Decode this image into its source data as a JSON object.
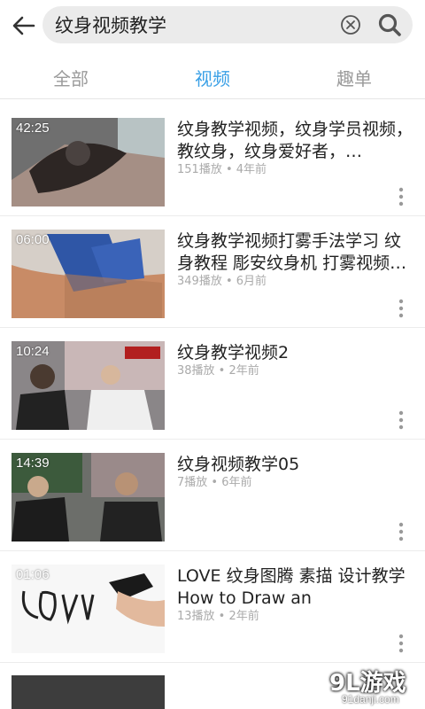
{
  "search": {
    "query": "纹身视频教学"
  },
  "tabs": [
    {
      "label": "全部"
    },
    {
      "label": "视频"
    },
    {
      "label": "趣单"
    }
  ],
  "active_tab": "视频",
  "accent_color": "#3aa0e6",
  "videos": [
    {
      "duration": "42:25",
      "title": "纹身教学视频，纹身学员视频，教纹身，纹身爱好者，…",
      "plays": "151播放",
      "age": "4年前"
    },
    {
      "duration": "06:00",
      "title": "纹身教学视频打雾手法学习 纹身教程 彫安纹身机 打雾视频…",
      "plays": "349播放",
      "age": "6月前"
    },
    {
      "duration": "10:24",
      "title": "纹身教学视频2",
      "plays": "38播放",
      "age": "2年前"
    },
    {
      "duration": "14:39",
      "title": "纹身视频教学05",
      "plays": "7播放",
      "age": "6年前"
    },
    {
      "duration": "01:06",
      "title": "LOVE 纹身图腾 素描 设计教学How to Draw an",
      "plays": "13播放",
      "age": "2年前"
    }
  ],
  "watermark": {
    "main": "9L游戏",
    "sub": "91danji.com"
  },
  "icons": {
    "back": "arrow-left-icon",
    "clear": "clear-circle-icon",
    "search": "search-icon",
    "more": "more-vertical-icon"
  }
}
